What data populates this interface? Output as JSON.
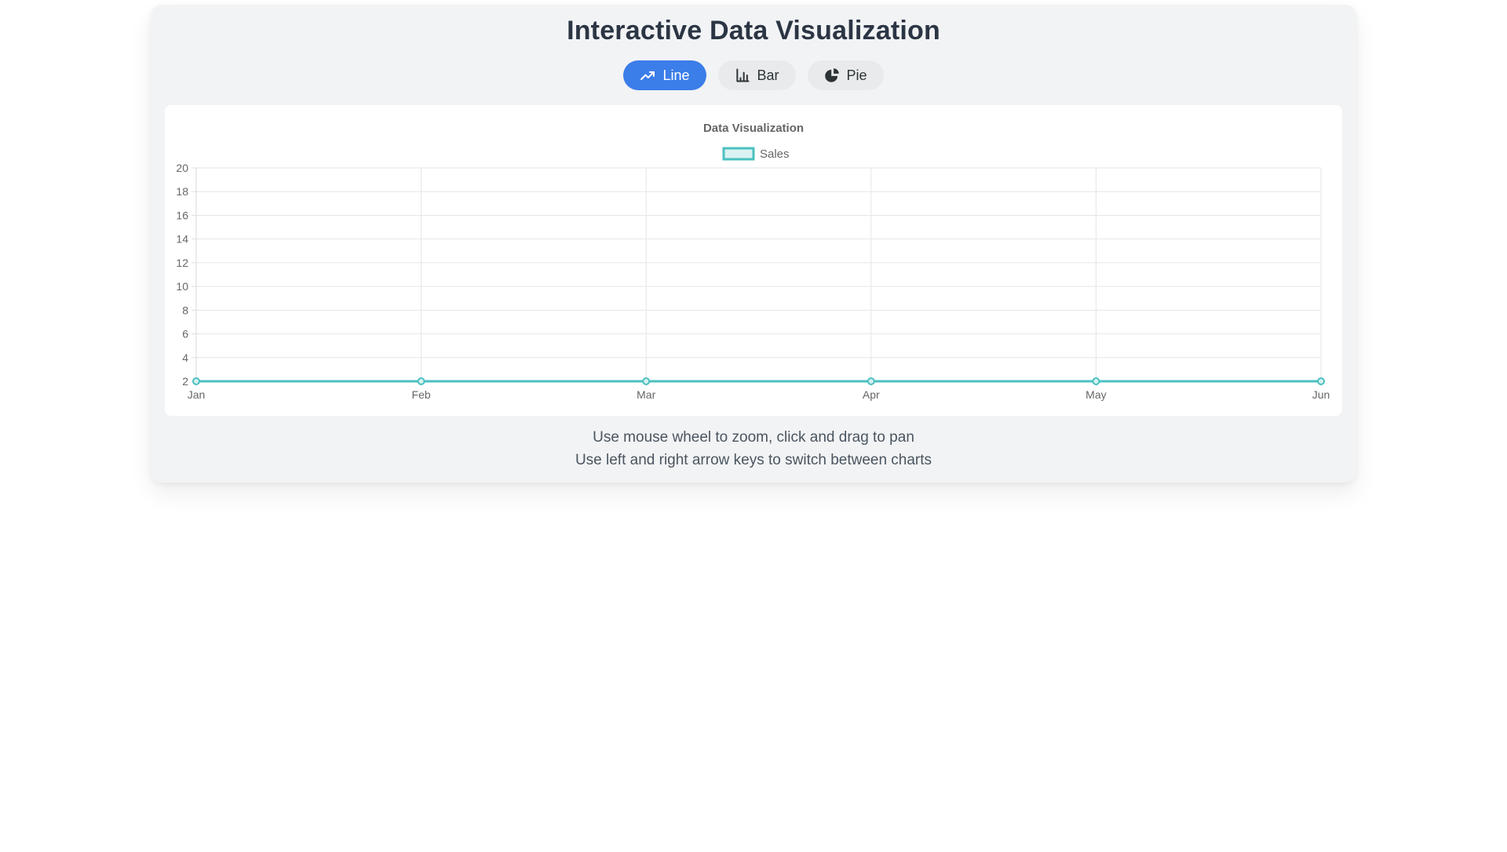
{
  "page": {
    "background": "#ffffff",
    "panel_background": "#f2f3f5",
    "card_background": "#ffffff"
  },
  "header": {
    "title": "Interactive Data Visualization"
  },
  "controls": {
    "buttons": [
      {
        "id": "line",
        "label": "Line",
        "icon": "line-chart-icon",
        "active": true
      },
      {
        "id": "bar",
        "label": "Bar",
        "icon": "bar-chart-icon",
        "active": false
      },
      {
        "id": "pie",
        "label": "Pie",
        "icon": "pie-chart-icon",
        "active": false
      }
    ],
    "active_bg": "#3b7de9",
    "active_fg": "#ffffff",
    "inactive_bg": "#e8eaec",
    "inactive_fg": "#2d3436"
  },
  "chart_data": {
    "type": "line",
    "title": "Data Visualization",
    "legend_position": "top",
    "categories": [
      "Jan",
      "Feb",
      "Mar",
      "Apr",
      "May",
      "Jun"
    ],
    "series": [
      {
        "name": "Sales",
        "values": [
          2,
          2,
          2,
          2,
          2,
          2
        ],
        "line_color": "#4bc0c0",
        "fill_color": "rgba(75,192,192,0.2)",
        "point_fill": "#d7f0f0"
      }
    ],
    "y_ticks": [
      20,
      18,
      16,
      14,
      12,
      10,
      8,
      6,
      4,
      2
    ],
    "ylim": [
      2,
      20
    ],
    "xlabel": "",
    "ylabel": "",
    "grid": true,
    "label_color": "#666666",
    "grid_color": "#e4e6e8"
  },
  "instructions": {
    "line1": "Use mouse wheel to zoom, click and drag to pan",
    "line2": "Use left and right arrow keys to switch between charts"
  }
}
